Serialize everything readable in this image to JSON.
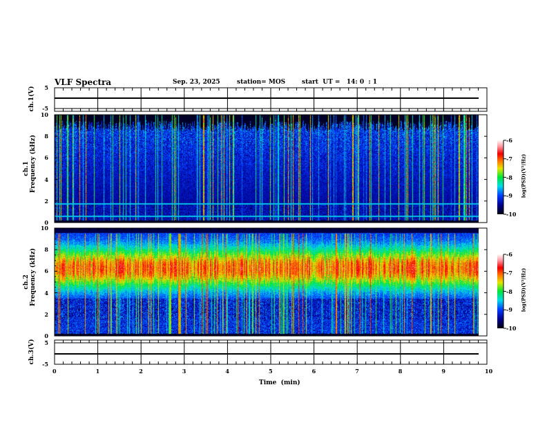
{
  "header": {
    "title": "VLF Spectra",
    "date": "Sep. 23, 2025",
    "station": "station= MOS",
    "start_ut": "start  UT =   14: 0  : 1"
  },
  "chart_data": [
    {
      "type": "line",
      "ylabel": "ch.1(V)",
      "ylim": [
        -5,
        5
      ],
      "yticks": [
        "5",
        "-5"
      ],
      "note_values": "flat trace near 0 V",
      "xlim": [
        0,
        10
      ]
    },
    {
      "type": "heatmap",
      "ylabel_line1": "ch.1",
      "ylabel_line2": "Frequency  (kHz)",
      "ylim": [
        0,
        10
      ],
      "yticks": [
        "0",
        "2",
        "4",
        "6",
        "8",
        "10"
      ],
      "xlim": [
        0,
        10
      ],
      "data_end_min": 9.85,
      "colorbar": {
        "label": "log(PSD)(V²/Hz)",
        "range": [
          -10,
          -6
        ],
        "ticks": [
          "-6",
          "-7",
          "-8",
          "-9",
          "-10"
        ]
      }
    },
    {
      "type": "heatmap",
      "ylabel_line1": "ch.2",
      "ylabel_line2": "Frequency  (kHz)",
      "ylim": [
        0,
        10
      ],
      "yticks": [
        "0",
        "2",
        "4",
        "6",
        "8",
        "10"
      ],
      "xlim": [
        0,
        10
      ],
      "data_end_min": 9.85,
      "colorbar": {
        "label": "log(PSD)(V²/Hz)",
        "range": [
          -10,
          -6
        ],
        "ticks": [
          "-6",
          "-7",
          "-8",
          "-9",
          "-10"
        ]
      }
    },
    {
      "type": "line",
      "ylabel": "ch.3(V)",
      "ylim": [
        -5,
        5
      ],
      "yticks": [
        "5",
        "-5"
      ],
      "xlim": [
        0,
        10
      ]
    }
  ],
  "xaxis": {
    "label": "Time  (min)",
    "ticks": [
      "0",
      "1",
      "2",
      "3",
      "4",
      "5",
      "6",
      "7",
      "8",
      "9",
      "10"
    ]
  },
  "colors": {
    "axis": "#000000",
    "background": "#ffffff"
  }
}
